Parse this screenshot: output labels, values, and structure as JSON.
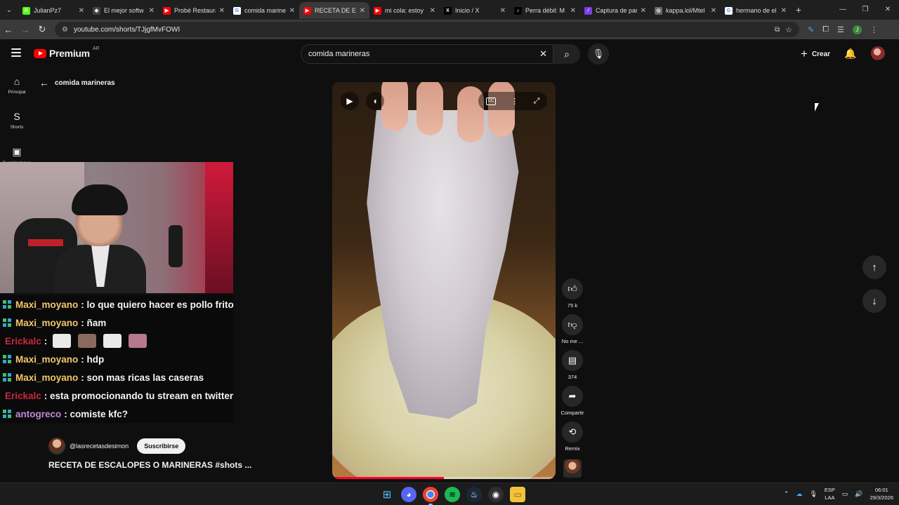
{
  "browser": {
    "tabs": [
      {
        "label": "JulianPz7",
        "favicon_color": "#53fc18",
        "favicon_glyph": "K"
      },
      {
        "label": "El mejor softw",
        "favicon_color": "#444444",
        "favicon_glyph": "◆"
      },
      {
        "label": "Probé Restaura",
        "favicon_color": "#ff0000",
        "favicon_glyph": "▶"
      },
      {
        "label": "comida marine",
        "favicon_color": "#ffffff",
        "favicon_glyph": "G"
      },
      {
        "label": "RECETA DE ESC",
        "favicon_color": "#ff0000",
        "favicon_glyph": "▶"
      },
      {
        "label": "mi cola: estoy",
        "favicon_color": "#ff0000",
        "favicon_glyph": "▶"
      },
      {
        "label": "Inicio / X",
        "favicon_color": "#000000",
        "favicon_glyph": "X"
      },
      {
        "label": "Perra débil: M",
        "favicon_color": "#000000",
        "favicon_glyph": "♪"
      },
      {
        "label": "Captura de par",
        "favicon_color": "#7b3fe4",
        "favicon_glyph": "⁄"
      },
      {
        "label": "kappa.lol/Mtel",
        "favicon_color": "#666666",
        "favicon_glyph": "◎"
      },
      {
        "label": "hermano de el",
        "favicon_color": "#ffffff",
        "favicon_glyph": "G"
      }
    ],
    "new_tab": "+",
    "url": "youtube.com/shorts/TJjgfMvFOWI",
    "profile_initial": "J"
  },
  "youtube": {
    "logo_text": "Premium",
    "region": "AR",
    "search_query": "comida marineras",
    "create_label": "Crear",
    "sidebar": [
      {
        "label": "Principal",
        "icon": "home-icon",
        "glyph": "⌂"
      },
      {
        "label": "Shorts",
        "icon": "shorts-icon",
        "glyph": "S"
      },
      {
        "label": "Suscripciones",
        "icon": "subscriptions-icon",
        "glyph": "▣"
      }
    ],
    "back_label": "comida marineras",
    "short": {
      "progress": 0.5,
      "channel_handle": "@lasrecetasdesimon",
      "subscribe_label": "Suscribirse",
      "title": "RECETA DE ESCALOPES O MARINERAS #shots ..."
    },
    "actions": {
      "like_count": "75 k",
      "dislike_label": "No me ...",
      "comments_count": "374",
      "share_label": "Compartir",
      "remix_label": "Remix"
    }
  },
  "stream_chat": [
    {
      "user": "Maxi_moyano",
      "color": "#f4c76b",
      "badge": true,
      "text": ": lo que quiero hacer es pollo frito"
    },
    {
      "user": "Maxi_moyano",
      "color": "#f4c76b",
      "badge": true,
      "text": ": ñam"
    },
    {
      "user": "Erickalc",
      "color": "#c8283d",
      "badge": false,
      "text": ":",
      "emotes": true
    },
    {
      "user": "Maxi_moyano",
      "color": "#f4c76b",
      "badge": true,
      "text": ": hdp"
    },
    {
      "user": "Maxi_moyano",
      "color": "#f4c76b",
      "badge": true,
      "text": ": son mas ricas las caseras"
    },
    {
      "user": "Erickalc",
      "color": "#c8283d",
      "badge": false,
      "text": ": esta promocionando tu stream en twitter"
    },
    {
      "user": "antogreco",
      "color": "#c08ad8",
      "badge": true,
      "text": ": comiste kfc?"
    }
  ],
  "taskbar": {
    "lang_top": "ESP",
    "lang_bottom": "LAA",
    "time": "06:01",
    "date": "29/3/2026"
  }
}
